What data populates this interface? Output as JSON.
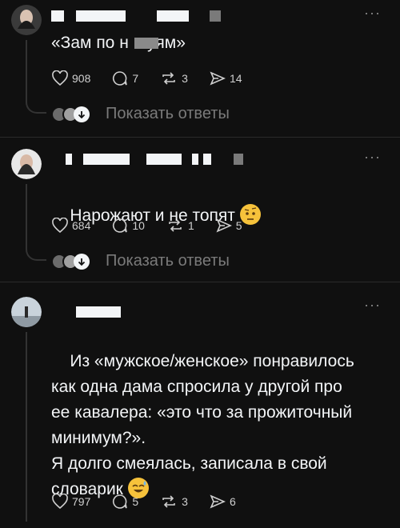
{
  "posts": [
    {
      "text": "«Зам по н    уям»",
      "likes": "908",
      "comments": "7",
      "reposts": "3",
      "shares": "14",
      "replies_label": "Показать ответы"
    },
    {
      "text": "Нарожают и не топят",
      "emoji": "raised-eyebrow-emoji",
      "likes": "684",
      "comments": "10",
      "reposts": "1",
      "shares": "5",
      "replies_label": "Показать ответы"
    },
    {
      "text": "Из «мужское/женское» понравилось\nкак одна дама спросила у другой про\nее кавалера: «это что за прожиточный\nминимум?».\nЯ долго смеялась, записала в свой\nсловарик",
      "emoji": "sweat-smile-emoji",
      "likes": "797",
      "comments": "5",
      "reposts": "3",
      "shares": "6"
    }
  ],
  "icons": {
    "like": "heart-icon",
    "comment": "comment-icon",
    "repost": "repost-icon",
    "share": "share-icon",
    "more": "more-icon"
  }
}
